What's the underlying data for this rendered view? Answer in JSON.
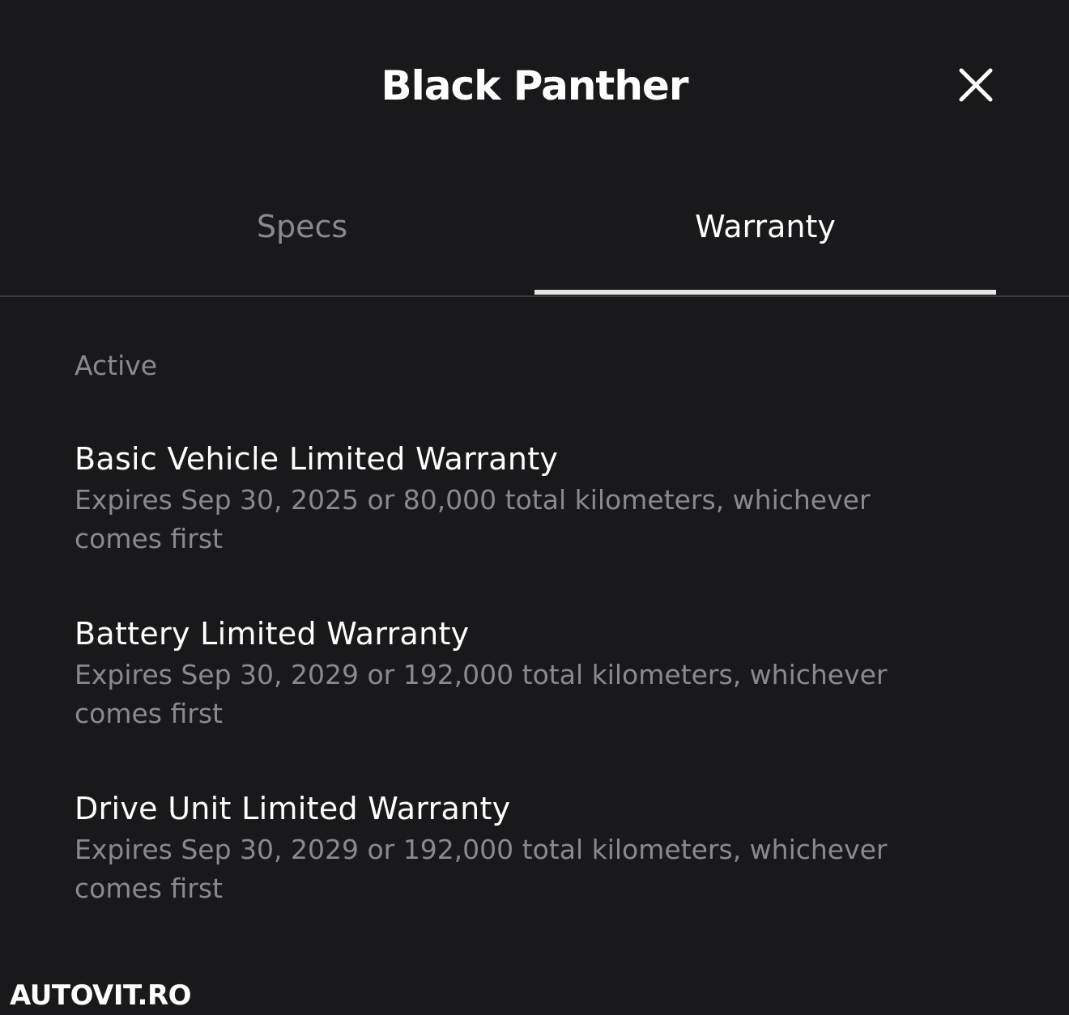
{
  "header": {
    "title": "Black Panther",
    "close_icon": "close-icon"
  },
  "tabs": [
    {
      "label": "Specs",
      "selected": false
    },
    {
      "label": "Warranty",
      "selected": true
    }
  ],
  "section": {
    "label": "Active"
  },
  "warranties": [
    {
      "title": "Basic Vehicle Limited Warranty",
      "description": "Expires Sep 30, 2025 or 80,000 total kilometers, whichever comes first"
    },
    {
      "title": "Battery Limited Warranty",
      "description": "Expires Sep 30, 2029 or 192,000 total kilometers, whichever comes first"
    },
    {
      "title": "Drive Unit Limited Warranty",
      "description": "Expires Sep 30, 2029 or 192,000 total kilometers, whichever comes first"
    }
  ],
  "watermark": "AUTOVIT.RO",
  "colors": {
    "background": "#19191b",
    "primary_text": "#ffffff",
    "secondary_text": "#8a8a8c",
    "tab_indicator": "#e6e6e6"
  }
}
